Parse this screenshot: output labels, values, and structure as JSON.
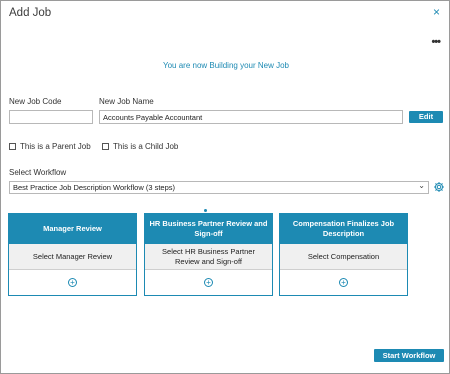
{
  "dialog": {
    "title": "Add Job",
    "close_glyph": "×",
    "more_glyph": "•••",
    "banner": "You are now Building your New Job"
  },
  "form": {
    "job_code_label": "New Job Code",
    "job_code_value": "",
    "job_name_label": "New Job Name",
    "job_name_value": "Accounts Payable Accountant",
    "edit_label": "Edit",
    "parent_label": "This is a Parent Job",
    "child_label": "This is a Child Job",
    "workflow_label": "Select Workflow",
    "workflow_value": "Best Practice Job Description Workflow (3 steps)",
    "chevron_glyph": "⌄"
  },
  "steps": [
    {
      "title": "Manager Review",
      "select_label": "Select Manager Review"
    },
    {
      "title": "HR Business Partner Review and Sign-off",
      "select_label": "Select HR Business Partner Review and Sign-off"
    },
    {
      "title": "Compensation Finalizes Job Description",
      "select_label": "Select Compensation"
    }
  ],
  "plus_glyph": "+",
  "footer": {
    "start_label": "Start Workflow"
  },
  "colors": {
    "accent": "#1d8ab3",
    "text": "#333333",
    "border": "#b8b8b8",
    "card_select_bg": "#f0f0f0"
  },
  "icons": {
    "close": "close-icon",
    "more": "more-options-icon",
    "gear": "gear-icon",
    "add": "add-circle-icon",
    "chevron": "chevron-down-icon"
  }
}
